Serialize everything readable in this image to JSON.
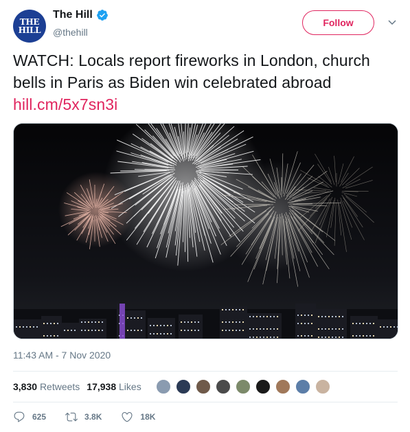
{
  "account": {
    "avatar_text_line1": "THE",
    "avatar_text_line2": "HILL",
    "display_name": "The Hill",
    "verified_icon": "verified-badge-icon",
    "handle": "@thehill"
  },
  "follow_label": "Follow",
  "tweet": {
    "text": "WATCH: Locals report fireworks in London, church bells in Paris as Biden win celebrated abroad",
    "link": "hill.cm/5x7sn3i"
  },
  "media": {
    "description_icon": "fireworks-photo"
  },
  "timestamp": "11:43 AM - 7 Nov 2020",
  "stats": {
    "retweets_count": "3,830",
    "retweets_label": "Retweets",
    "likes_count": "17,938",
    "likes_label": "Likes"
  },
  "liker_avatars": [
    "#8a9bb0",
    "#2b3a55",
    "#6f5a4a",
    "#4b4b4b",
    "#7c8a6a",
    "#1a1a1a",
    "#a0785a",
    "#5c7ea8",
    "#c9b3a0"
  ],
  "actions": {
    "reply_count": "625",
    "retweet_count": "3.8K",
    "like_count": "18K"
  },
  "colors": {
    "accent": "#e0245e",
    "verified": "#1da1f2",
    "muted": "#657786"
  }
}
